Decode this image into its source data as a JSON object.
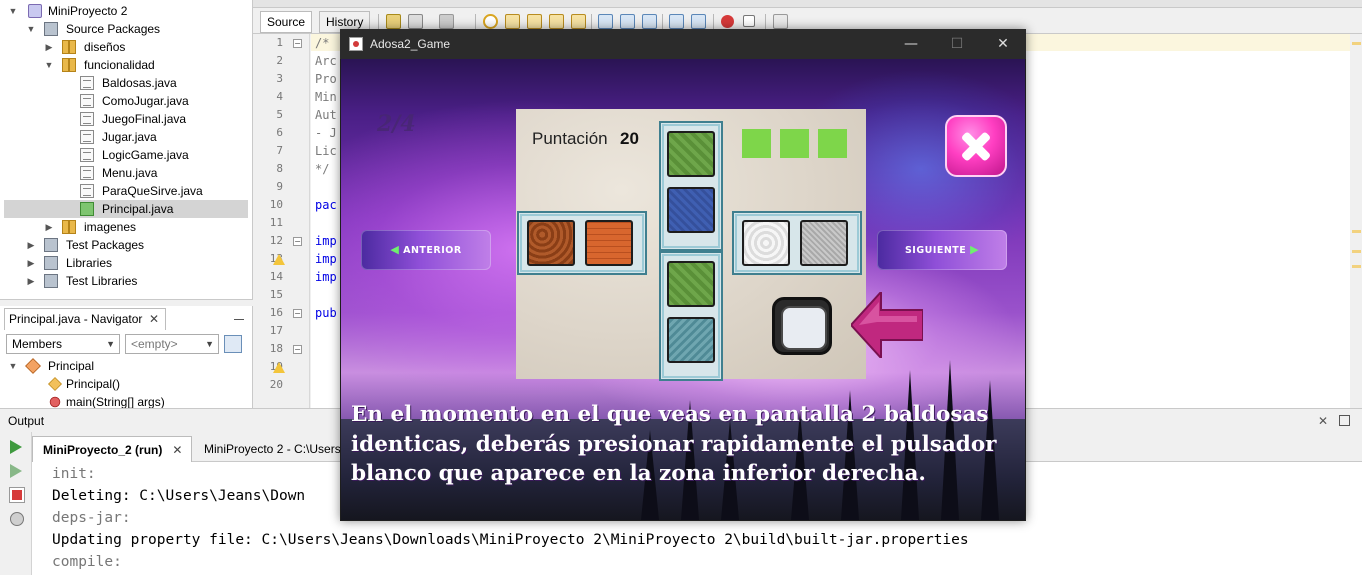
{
  "project_tree": {
    "items": [
      {
        "label": "MiniProyecto 2"
      },
      {
        "label": "Source Packages"
      },
      {
        "label": "diseños"
      },
      {
        "label": "funcionalidad"
      },
      {
        "label": "Baldosas.java"
      },
      {
        "label": "ComoJugar.java"
      },
      {
        "label": "JuegoFinal.java"
      },
      {
        "label": "Jugar.java"
      },
      {
        "label": "LogicGame.java"
      },
      {
        "label": "Menu.java"
      },
      {
        "label": "ParaQueSirve.java"
      },
      {
        "label": "Principal.java"
      },
      {
        "label": "imagenes"
      },
      {
        "label": "Test Packages"
      },
      {
        "label": "Libraries"
      },
      {
        "label": "Test Libraries"
      }
    ]
  },
  "navigator": {
    "tab_label": "Principal.java - Navigator",
    "combo_members": "Members",
    "combo_filter": "<empty>",
    "items": [
      {
        "label": "Principal"
      },
      {
        "label": "Principal()"
      },
      {
        "label": "main(String[] args)"
      }
    ]
  },
  "editor": {
    "tab_source": "Source",
    "tab_history": "History",
    "line_numbers": [
      "1",
      "2",
      "3",
      "4",
      "5",
      "6",
      "7",
      "8",
      "9",
      "10",
      "11",
      "12",
      "13",
      "14",
      "15",
      "16",
      "17",
      "18",
      "19",
      "20"
    ],
    "code_lines": [
      "/*",
      "Arc",
      "Pro",
      "Min",
      "Aut",
      "- J",
      "Lic",
      "*/",
      "pac",
      "imp",
      "imp",
      "imp",
      "pub"
    ]
  },
  "output": {
    "title": "Output",
    "tab_run": "MiniProyecto_2 (run)",
    "tab_build": "MiniProyecto 2 - C:\\Users",
    "lines": [
      "init:",
      "Deleting: C:\\Users\\Jeans\\Down",
      "deps-jar:",
      "Updating property file: C:\\Users\\Jeans\\Downloads\\MiniProyecto 2\\MiniProyecto 2\\build\\built-jar.properties",
      "compile:"
    ]
  },
  "game": {
    "window_title": "Adosa2_Game",
    "page_indicator": "2/4",
    "score_label": "Puntación",
    "score_value": "20",
    "lives": 3,
    "prev_button": "ANTERIOR",
    "next_button": "SIGUIENTE",
    "instructions": "En el momento en el que veas en pantalla 2 baldosas identicas, deberás presionar rapidamente el pulsador blanco que aparece en la zona inferior derecha.",
    "colors": {
      "life": "#7ed64a",
      "close_button": "#ff3fc2",
      "pointer_arrow": "#c0287f"
    }
  }
}
